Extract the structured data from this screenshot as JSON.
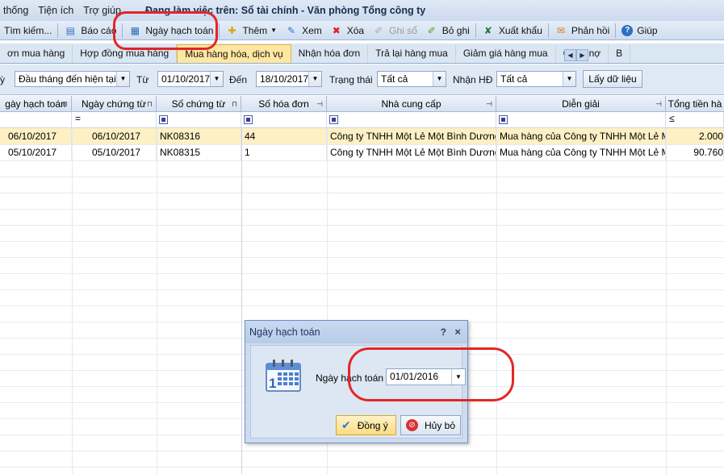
{
  "menubar": {
    "items": [
      "thống",
      "Tiện ích",
      "Trợ giúp"
    ],
    "title": "Đang làm việc trên: Sổ tài chính - Văn phòng Tổng công ty"
  },
  "toolbar": {
    "search": "Tìm kiếm...",
    "report": "Báo cáo",
    "posting_date": "Ngày hạch toán",
    "add": "Thêm",
    "view": "Xem",
    "delete": "Xóa",
    "post": "Ghi sổ",
    "unpost": "Bỏ ghi",
    "export": "Xuất khẩu",
    "feedback": "Phản hồi",
    "help": "Giúp"
  },
  "tabs": [
    {
      "label": "ơn mua hàng",
      "active": false
    },
    {
      "label": "Hợp đồng mua hàng",
      "active": false
    },
    {
      "label": "Mua hàng hóa, dịch vụ",
      "active": true
    },
    {
      "label": "Nhận hóa đơn",
      "active": false
    },
    {
      "label": "Trả lại hàng mua",
      "active": false
    },
    {
      "label": "Giảm giá hàng mua",
      "active": false
    },
    {
      "label": "Công nợ",
      "active": false
    },
    {
      "label": "B",
      "active": false
    }
  ],
  "filter": {
    "period_label": "ỳ",
    "period": "Đầu tháng đến hiện tại",
    "from_label": "Từ",
    "from": "01/10/2017",
    "to_label": "Đến",
    "to": "18/10/2017",
    "status_label": "Trạng thái",
    "status": "Tất cả",
    "invoice_label": "Nhận HĐ",
    "invoice": "Tất cả",
    "fetch_button": "Lấy dữ liệu"
  },
  "grid": {
    "columns": [
      "gày hạch toán",
      "Ngày chứng từ",
      "Số chứng từ",
      "Số hóa đơn",
      "Nhà cung cấp",
      "Diễn giải",
      "Tổng tiền hà"
    ],
    "filter_ops": [
      "",
      "=",
      "",
      "",
      "",
      "",
      "≤"
    ],
    "rows": [
      [
        "06/10/2017",
        "06/10/2017",
        "NK08316",
        "44",
        "Công ty TNHH Một Lẻ Một Bình Dương",
        "Mua hàng của Công ty TNHH Một Lẻ M",
        "2.000"
      ],
      [
        "05/10/2017",
        "05/10/2017",
        "NK08315",
        "1",
        "Công ty TNHH Một Lẻ Một Bình Dương",
        "Mua hàng của Công ty TNHH Một Lẻ M",
        "90.760"
      ]
    ]
  },
  "dialog": {
    "title": "Ngày hạch toán",
    "help": "?",
    "close": "×",
    "label": "Ngày hạch toán",
    "value": "01/01/2016",
    "ok": "Đồng ý",
    "cancel": "Hủy bỏ"
  },
  "colors": {
    "annotation": "#e32626",
    "active_tab": "#ffe7a2",
    "selected_row": "#fdf0c4"
  }
}
